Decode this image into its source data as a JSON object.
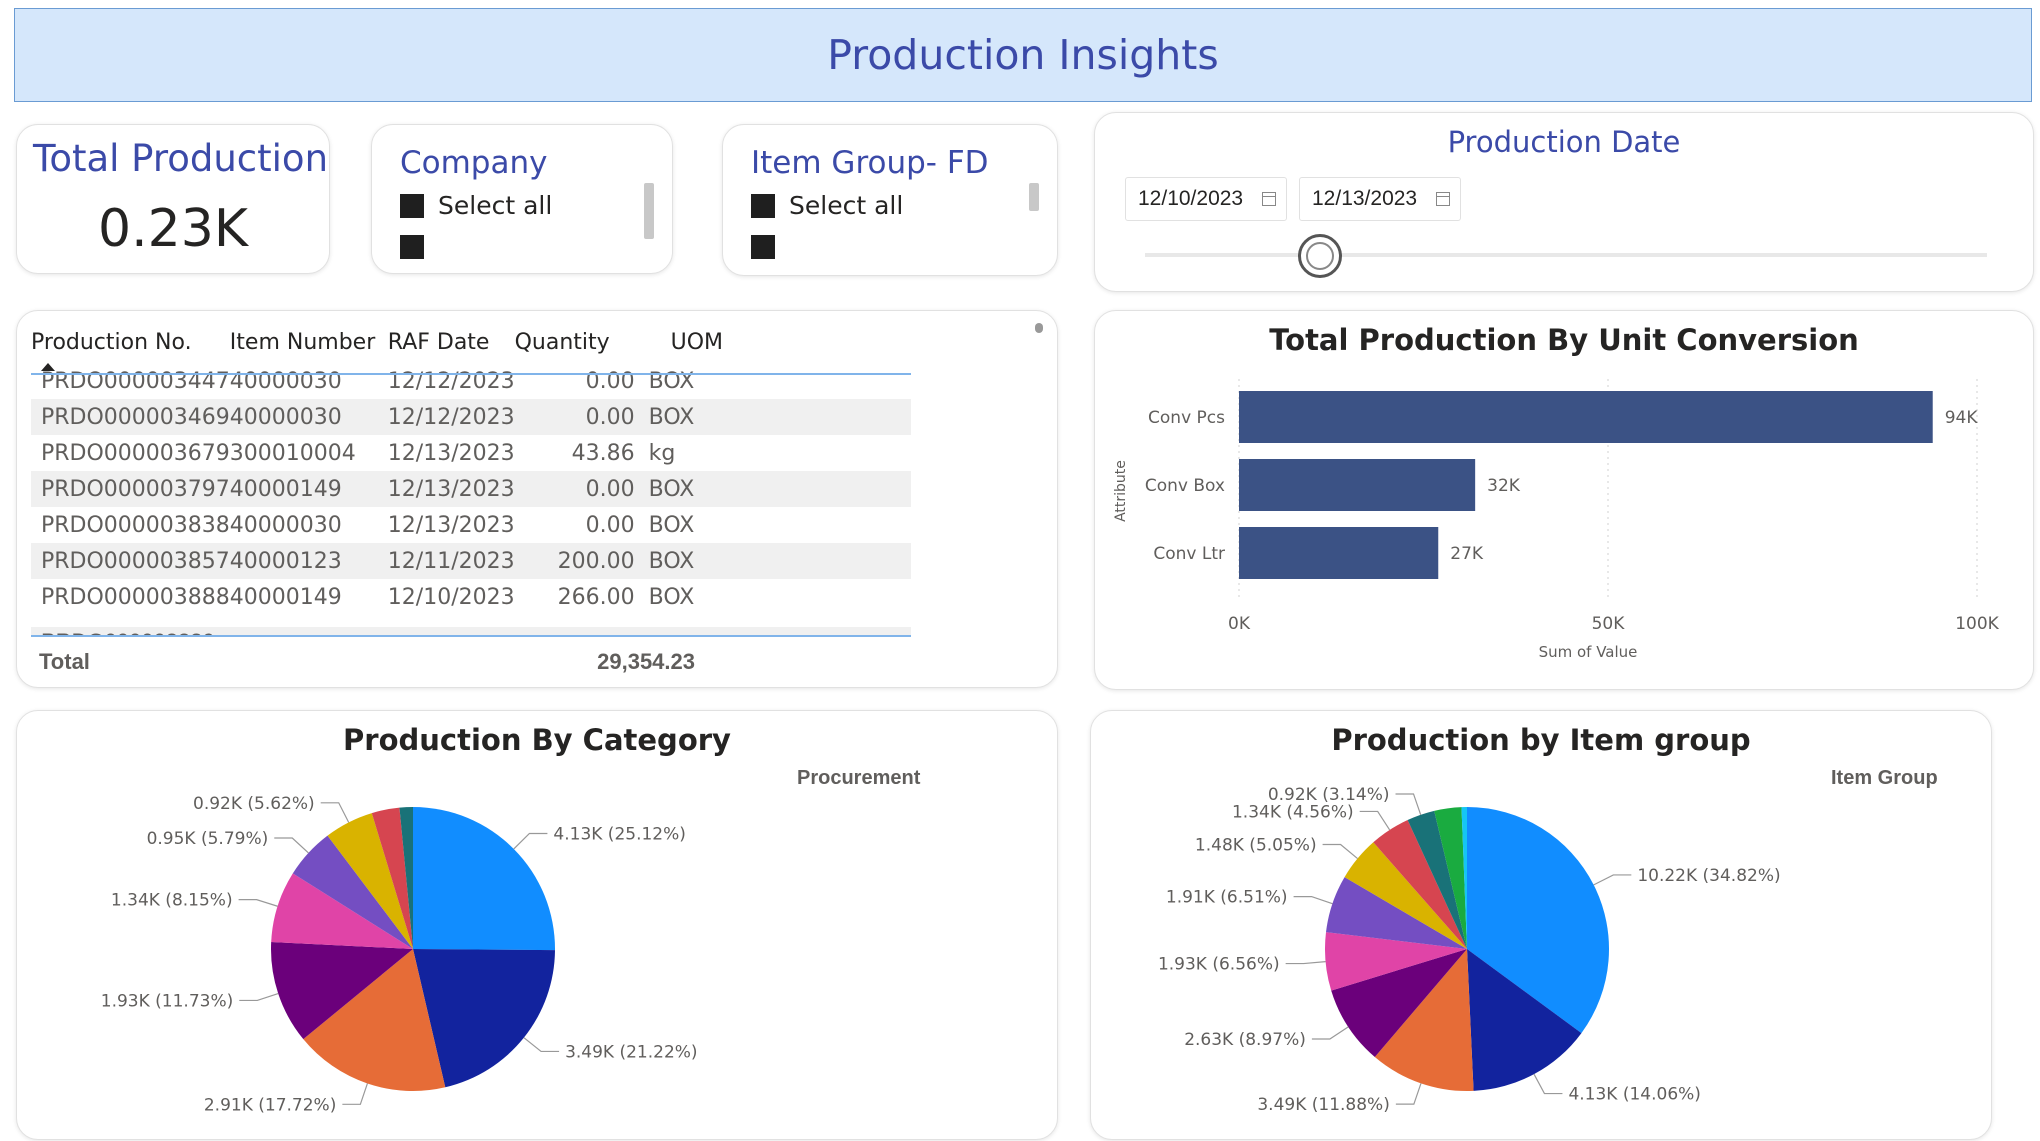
{
  "header": {
    "title": "Production Insights"
  },
  "kpi": {
    "label": "Total Production",
    "value": "0.23K"
  },
  "company_slicer": {
    "title": "Company",
    "items": [
      {
        "label": "Select all"
      },
      {
        "label": ""
      }
    ]
  },
  "item_group_slicer": {
    "title": "Item Group- FD",
    "items": [
      {
        "label": "Select all"
      },
      {
        "label": ""
      }
    ]
  },
  "date_slicer": {
    "title": "Production Date",
    "start": "12/10/2023",
    "end": "12/13/2023"
  },
  "table": {
    "columns": [
      "Production No.",
      "Item Number",
      "RAF Date",
      "Quantity",
      "UOM"
    ],
    "sort_column": "Production No.",
    "rows": [
      [
        "PRDO000003447",
        "40000030",
        "12/12/2023",
        "0.00",
        "BOX"
      ],
      [
        "PRDO000003469",
        "40000030",
        "12/12/2023",
        "0.00",
        "BOX"
      ],
      [
        "PRDO000003679",
        "300010004",
        "12/13/2023",
        "43.86",
        "kg"
      ],
      [
        "PRDO000003797",
        "40000149",
        "12/13/2023",
        "0.00",
        "BOX"
      ],
      [
        "PRDO000003838",
        "40000030",
        "12/13/2023",
        "0.00",
        "BOX"
      ],
      [
        "PRDO000003857",
        "40000123",
        "12/11/2023",
        "200.00",
        "BOX"
      ],
      [
        "PRDO000003888",
        "40000149",
        "12/10/2023",
        "266.00",
        "BOX"
      ]
    ],
    "total_label": "Total",
    "total_quantity": "29,354.23"
  },
  "colors": {
    "bar": "#3b5285",
    "pie": [
      "#118dff",
      "#12239e",
      "#e66c37",
      "#6b007b",
      "#e044a7",
      "#744ec2",
      "#d9b300",
      "#d64550",
      "#197278",
      "#1aab40",
      "#15c6f4"
    ]
  },
  "chart_data": [
    {
      "type": "bar",
      "orientation": "horizontal",
      "title": "Total Production By Unit Conversion",
      "xlabel": "Sum of Value",
      "ylabel": "Attribute",
      "categories": [
        "Conv Pcs",
        "Conv Box",
        "Conv Ltr"
      ],
      "values": [
        94000,
        32000,
        27000
      ],
      "data_labels": [
        "94K",
        "32K",
        "27K"
      ],
      "xlim": [
        0,
        100000
      ],
      "xticks": [
        "0K",
        "50K",
        "100K"
      ],
      "grid": true
    },
    {
      "type": "pie",
      "title": "Production By Category",
      "legend_title": "Procurement",
      "values": [
        4130,
        3490,
        2910,
        1930,
        1340,
        950,
        920,
        520,
        250
      ],
      "labels": [
        "4.13K (25.12%)",
        "3.49K (21.22%)",
        "2.91K (17.72%)",
        "1.93K (11.73%)",
        "1.34K (8.15%)",
        "0.95K (5.79%)",
        "0.92K (5.62%)",
        "",
        ""
      ]
    },
    {
      "type": "pie",
      "title": "Production by Item group",
      "legend_title": "Item Group",
      "values": [
        10220,
        4130,
        3490,
        2630,
        1930,
        1910,
        1480,
        1340,
        920,
        900,
        180
      ],
      "labels": [
        "10.22K (34.82%)",
        "4.13K (14.06%)",
        "3.49K (11.88%)",
        "2.63K (8.97%)",
        "1.93K (6.56%)",
        "1.91K (6.51%)",
        "1.48K (5.05%)",
        "1.34K (4.56%)",
        "0.92K (3.14%)",
        "",
        ""
      ]
    }
  ]
}
